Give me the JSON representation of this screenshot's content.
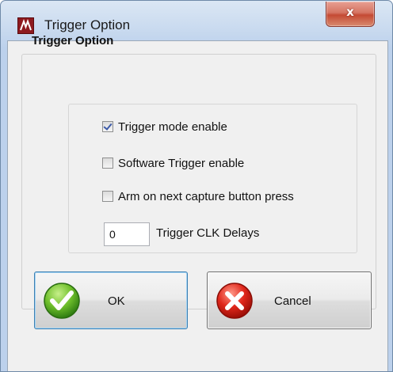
{
  "window": {
    "title": "Trigger Option",
    "close_glyph": "x"
  },
  "group": {
    "title": "Trigger Option"
  },
  "options": [
    {
      "label": "Trigger mode enable",
      "checked": true
    },
    {
      "label": "Software Trigger enable",
      "checked": false
    },
    {
      "label": "Arm on next capture button press",
      "checked": false
    }
  ],
  "delay": {
    "value": "0",
    "label": "Trigger CLK Delays"
  },
  "buttons": {
    "ok_label": "OK",
    "cancel_label": "Cancel"
  },
  "icons": {
    "app": "app-logo-icon",
    "ok": "green-check-icon",
    "cancel": "red-x-icon"
  }
}
